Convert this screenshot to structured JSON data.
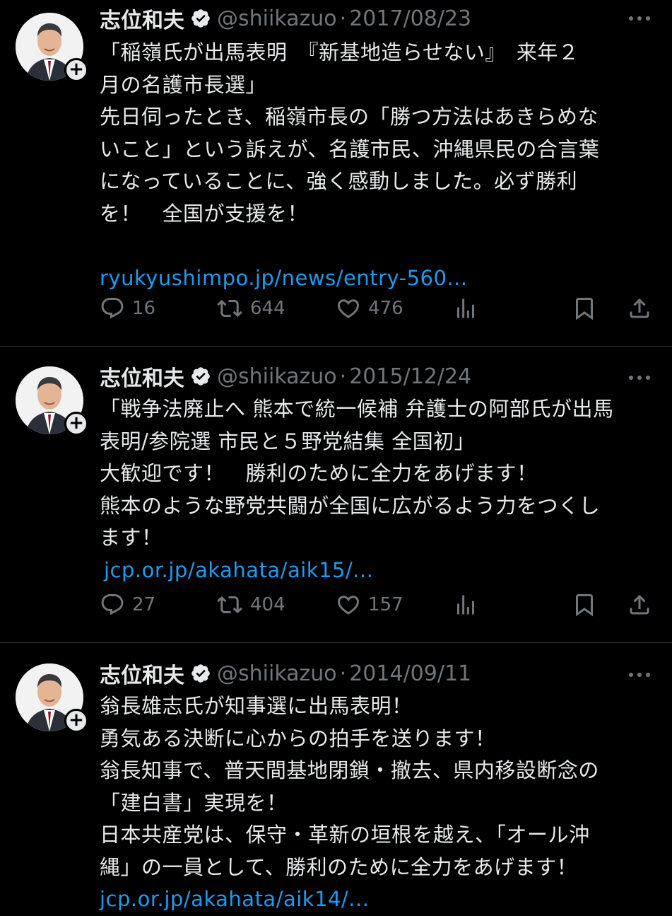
{
  "tweets": [
    {
      "name": "志位和夫",
      "handle": "@shiikazuo",
      "date": "2017/08/23",
      "lines": [
        "「稲嶺氏が出馬表明　『新基地造らせない』　来年２",
        "月の名護市長選」",
        "先日伺ったとき、稲嶺市長の「勝つ方法はあきらめな",
        "いこと」という訴えが、名護市民、沖縄県民の合言葉",
        "になっていることに、強く感動しました。必ず勝利",
        "を！　全国が支援を！",
        ""
      ],
      "link": "ryukyushimpo.jp/news/entry-560...",
      "replies": "16",
      "retweets": "644",
      "likes": "476"
    },
    {
      "name": "志位和夫",
      "handle": "@shiikazuo",
      "date": "2015/12/24",
      "lines": [
        "「戦争法廃止へ 熊本で統一候補 弁護士の阿部氏が出馬",
        "表明/参院選 市民と５野党結集 全国初」",
        "大歓迎です！　勝利のために全力をあげます！",
        "熊本のような野党共闘が全国に広がるよう力をつくし",
        "ます！"
      ],
      "link": "jcp.or.jp/akahata/aik15/...",
      "replies": "27",
      "retweets": "404",
      "likes": "157"
    },
    {
      "name": "志位和夫",
      "handle": "@shiikazuo",
      "date": "2014/09/11",
      "lines": [
        "翁長雄志氏が知事選に出馬表明！",
        "勇気ある決断に心からの拍手を送ります！",
        "翁長知事で、普天間基地閉鎖・撤去、県内移設断念の",
        "「建白書」実現を！",
        "日本共産党は、保守・革新の垣根を越え、「オール沖",
        "縄」の一員として、勝利のために全力をあげます！"
      ],
      "link": "jcp.or.jp/akahata/aik14/..."
    }
  ],
  "colors": {
    "background": "#000000",
    "text": "#e7e9ea",
    "muted": "#71767b",
    "link": "#1d9bf0",
    "divider": "#2f3336"
  },
  "icons": {
    "verified": "verified-badge-icon",
    "more": "more-options-icon",
    "reply": "reply-icon",
    "retweet": "retweet-icon",
    "like": "like-icon",
    "views": "analytics-icon",
    "bookmark": "bookmark-icon",
    "share": "share-icon",
    "follow": "follow-plus-icon"
  }
}
